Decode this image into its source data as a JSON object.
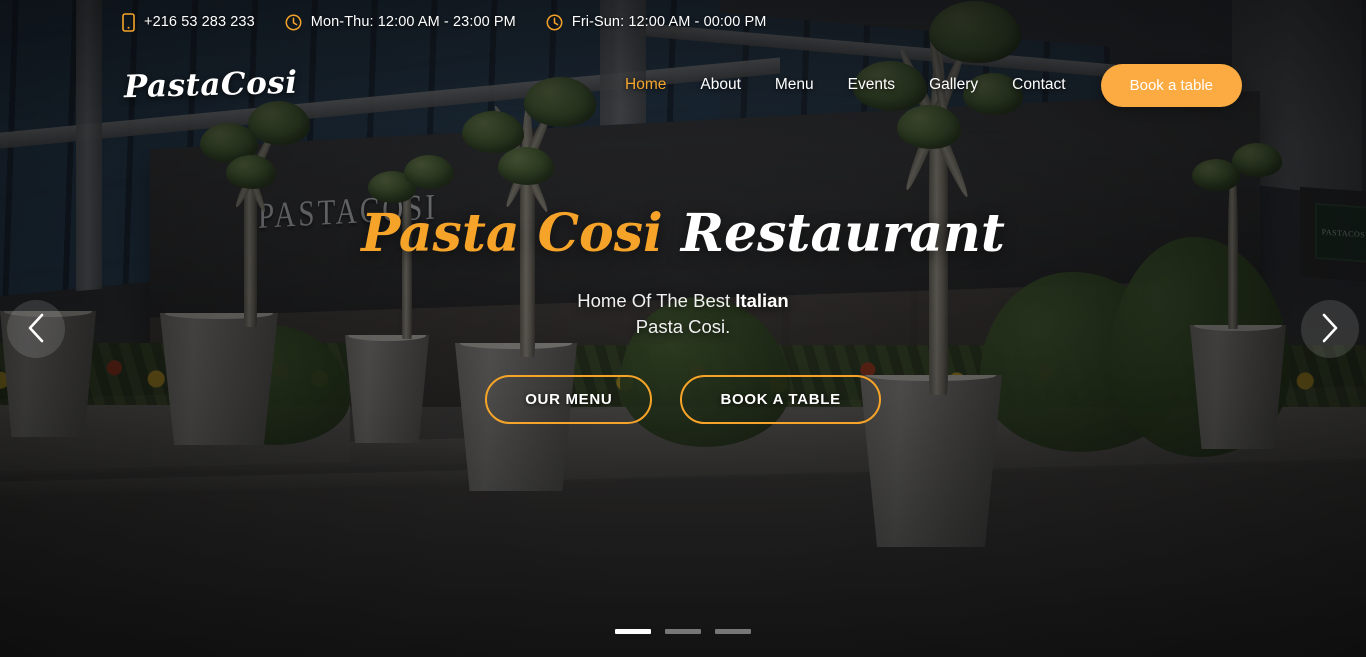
{
  "topbar": {
    "phone": {
      "icon": "mobile-phone-icon",
      "text": "+216 53 283 233"
    },
    "hours_weekday": {
      "icon": "clock-icon",
      "text": "Mon-Thu: 12:00 AM - 23:00 PM"
    },
    "hours_weekend": {
      "icon": "clock-icon",
      "text": "Fri-Sun: 12:00 AM - 00:00 PM"
    }
  },
  "nav": {
    "brand": "PastaCosi",
    "items": [
      {
        "label": "Home",
        "active": true
      },
      {
        "label": "About",
        "active": false
      },
      {
        "label": "Menu",
        "active": false
      },
      {
        "label": "Events",
        "active": false
      },
      {
        "label": "Gallery",
        "active": false
      },
      {
        "label": "Contact",
        "active": false
      }
    ],
    "book_button": "Book a table"
  },
  "hero": {
    "title_accent": "Pasta Cosi",
    "title_plain": "Restaurant",
    "subtitle_lead": "Home Of The Best ",
    "subtitle_bold": "Italian",
    "subtitle_line2": "Pasta Cosi.",
    "primary_button": "OUR MENU",
    "secondary_button": "BOOK A TABLE",
    "sign_text": "PASTACOSI",
    "plaque_text": "PASTACOSI"
  },
  "carousel": {
    "prev_icon": "chevron-left-icon",
    "next_icon": "chevron-right-icon",
    "slides": 3,
    "active_slide": 1
  },
  "colors": {
    "accent": "#f6a429",
    "button_fill": "#fbab42",
    "text_light": "#ffffff"
  }
}
